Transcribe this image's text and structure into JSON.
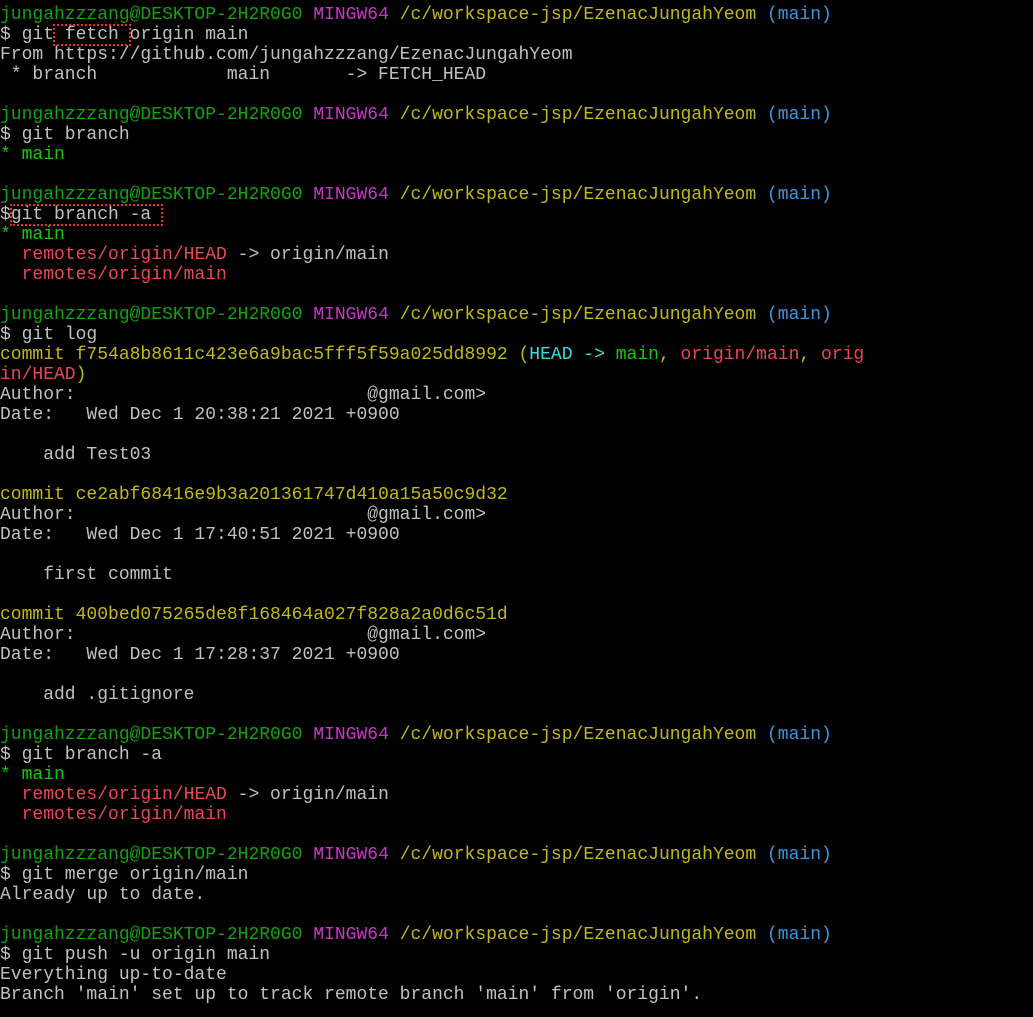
{
  "window": {
    "kind": "git-bash-terminal"
  },
  "colors": {
    "default": "#c0c0c0",
    "user_host": "#13a10e",
    "mingw": "#c836c8",
    "path": "#c1b81a",
    "branch_paren": "#3a96dd",
    "green": "#16c60c",
    "red": "#e74856",
    "yellow_hash": "#c1b81a",
    "head_cyan": "#3adbdb",
    "highlight_box": "#e03030"
  },
  "lines": [
    {
      "segs": [
        {
          "t": "jungahzzzang@DESKTOP-2H2R0G0",
          "c": "user_host"
        },
        {
          "t": " ",
          "c": "default"
        },
        {
          "t": "MINGW64",
          "c": "mingw"
        },
        {
          "t": " ",
          "c": "default"
        },
        {
          "t": "/c/workspace-jsp/EzenacJungahYeom",
          "c": "path"
        },
        {
          "t": " ",
          "c": "default"
        },
        {
          "t": "(main)",
          "c": "branch_paren"
        }
      ]
    },
    {
      "segs": [
        {
          "t": "$ git",
          "c": "default"
        },
        {
          "t": " fetch ",
          "c": "default",
          "hl": true
        },
        {
          "t": "origin main",
          "c": "default"
        }
      ]
    },
    {
      "segs": [
        {
          "t": "From https://github.com/jungahzzzang/EzenacJungahYeom",
          "c": "default"
        }
      ]
    },
    {
      "segs": [
        {
          "t": " * branch            main       -> FETCH_HEAD",
          "c": "default"
        }
      ]
    },
    {
      "segs": [
        {
          "t": "",
          "c": "default"
        }
      ]
    },
    {
      "segs": [
        {
          "t": "jungahzzzang@DESKTOP-2H2R0G0",
          "c": "user_host"
        },
        {
          "t": " ",
          "c": "default"
        },
        {
          "t": "MINGW64",
          "c": "mingw"
        },
        {
          "t": " ",
          "c": "default"
        },
        {
          "t": "/c/workspace-jsp/EzenacJungahYeom",
          "c": "path"
        },
        {
          "t": " ",
          "c": "default"
        },
        {
          "t": "(main)",
          "c": "branch_paren"
        }
      ]
    },
    {
      "segs": [
        {
          "t": "$ git branch",
          "c": "default"
        }
      ]
    },
    {
      "segs": [
        {
          "t": "* main",
          "c": "green"
        }
      ]
    },
    {
      "segs": [
        {
          "t": "",
          "c": "default"
        }
      ]
    },
    {
      "segs": [
        {
          "t": "jungahzzzang@DESKTOP-2H2R0G0",
          "c": "user_host"
        },
        {
          "t": " ",
          "c": "default"
        },
        {
          "t": "MINGW64",
          "c": "mingw"
        },
        {
          "t": " ",
          "c": "default"
        },
        {
          "t": "/c/workspace-jsp/EzenacJungahYeom",
          "c": "path"
        },
        {
          "t": " ",
          "c": "default"
        },
        {
          "t": "(main)",
          "c": "branch_paren"
        }
      ]
    },
    {
      "segs": [
        {
          "t": "$",
          "c": "default"
        },
        {
          "t": "git branch -a ",
          "c": "default",
          "hl": true
        }
      ]
    },
    {
      "segs": [
        {
          "t": "* main",
          "c": "green"
        }
      ]
    },
    {
      "segs": [
        {
          "t": "  ",
          "c": "default"
        },
        {
          "t": "remotes/origin/HEAD",
          "c": "red"
        },
        {
          "t": " -> origin/main",
          "c": "default"
        }
      ]
    },
    {
      "segs": [
        {
          "t": "  ",
          "c": "default"
        },
        {
          "t": "remotes/origin/main",
          "c": "red"
        }
      ]
    },
    {
      "segs": [
        {
          "t": "",
          "c": "default"
        }
      ]
    },
    {
      "segs": [
        {
          "t": "jungahzzzang@DESKTOP-2H2R0G0",
          "c": "user_host"
        },
        {
          "t": " ",
          "c": "default"
        },
        {
          "t": "MINGW64",
          "c": "mingw"
        },
        {
          "t": " ",
          "c": "default"
        },
        {
          "t": "/c/workspace-jsp/EzenacJungahYeom",
          "c": "path"
        },
        {
          "t": " ",
          "c": "default"
        },
        {
          "t": "(main)",
          "c": "branch_paren"
        }
      ]
    },
    {
      "segs": [
        {
          "t": "$ git log",
          "c": "default"
        }
      ]
    },
    {
      "segs": [
        {
          "t": "commit f754a8b8611c423e6a9bac5fff5f59a025dd8992 ",
          "c": "yellow_hash"
        },
        {
          "t": "(",
          "c": "yellow_hash"
        },
        {
          "t": "HEAD -> ",
          "c": "head_cyan"
        },
        {
          "t": "main",
          "c": "green"
        },
        {
          "t": ", ",
          "c": "yellow_hash"
        },
        {
          "t": "origin/main",
          "c": "red"
        },
        {
          "t": ", ",
          "c": "yellow_hash"
        },
        {
          "t": "orig",
          "c": "red"
        }
      ]
    },
    {
      "segs": [
        {
          "t": "in/HEAD",
          "c": "red"
        },
        {
          "t": ")",
          "c": "yellow_hash"
        }
      ]
    },
    {
      "segs": [
        {
          "t": "Author:                           @gmail.com>",
          "c": "default"
        }
      ]
    },
    {
      "segs": [
        {
          "t": "Date:   Wed Dec 1 20:38:21 2021 +0900",
          "c": "default"
        }
      ]
    },
    {
      "segs": [
        {
          "t": "",
          "c": "default"
        }
      ]
    },
    {
      "segs": [
        {
          "t": "    add Test03",
          "c": "default"
        }
      ]
    },
    {
      "segs": [
        {
          "t": "",
          "c": "default"
        }
      ]
    },
    {
      "segs": [
        {
          "t": "commit ce2abf68416e9b3a201361747d410a15a50c9d32",
          "c": "yellow_hash"
        }
      ]
    },
    {
      "segs": [
        {
          "t": "Author:                           @gmail.com>",
          "c": "default"
        }
      ]
    },
    {
      "segs": [
        {
          "t": "Date:   Wed Dec 1 17:40:51 2021 +0900",
          "c": "default"
        }
      ]
    },
    {
      "segs": [
        {
          "t": "",
          "c": "default"
        }
      ]
    },
    {
      "segs": [
        {
          "t": "    first commit",
          "c": "default"
        }
      ]
    },
    {
      "segs": [
        {
          "t": "",
          "c": "default"
        }
      ]
    },
    {
      "segs": [
        {
          "t": "commit 400bed075265de8f168464a027f828a2a0d6c51d",
          "c": "yellow_hash"
        }
      ]
    },
    {
      "segs": [
        {
          "t": "Author:                           @gmail.com>",
          "c": "default"
        }
      ]
    },
    {
      "segs": [
        {
          "t": "Date:   Wed Dec 1 17:28:37 2021 +0900",
          "c": "default"
        }
      ]
    },
    {
      "segs": [
        {
          "t": "",
          "c": "default"
        }
      ]
    },
    {
      "segs": [
        {
          "t": "    add .gitignore",
          "c": "default"
        }
      ]
    },
    {
      "segs": [
        {
          "t": "",
          "c": "default"
        }
      ]
    },
    {
      "segs": [
        {
          "t": "jungahzzzang@DESKTOP-2H2R0G0",
          "c": "user_host"
        },
        {
          "t": " ",
          "c": "default"
        },
        {
          "t": "MINGW64",
          "c": "mingw"
        },
        {
          "t": " ",
          "c": "default"
        },
        {
          "t": "/c/workspace-jsp/EzenacJungahYeom",
          "c": "path"
        },
        {
          "t": " ",
          "c": "default"
        },
        {
          "t": "(main)",
          "c": "branch_paren"
        }
      ]
    },
    {
      "segs": [
        {
          "t": "$ git branch -a",
          "c": "default"
        }
      ]
    },
    {
      "segs": [
        {
          "t": "* main",
          "c": "green"
        }
      ]
    },
    {
      "segs": [
        {
          "t": "  ",
          "c": "default"
        },
        {
          "t": "remotes/origin/HEAD",
          "c": "red"
        },
        {
          "t": " -> origin/main",
          "c": "default"
        }
      ]
    },
    {
      "segs": [
        {
          "t": "  ",
          "c": "default"
        },
        {
          "t": "remotes/origin/main",
          "c": "red"
        }
      ]
    },
    {
      "segs": [
        {
          "t": "",
          "c": "default"
        }
      ]
    },
    {
      "segs": [
        {
          "t": "jungahzzzang@DESKTOP-2H2R0G0",
          "c": "user_host"
        },
        {
          "t": " ",
          "c": "default"
        },
        {
          "t": "MINGW64",
          "c": "mingw"
        },
        {
          "t": " ",
          "c": "default"
        },
        {
          "t": "/c/workspace-jsp/EzenacJungahYeom",
          "c": "path"
        },
        {
          "t": " ",
          "c": "default"
        },
        {
          "t": "(main)",
          "c": "branch_paren"
        }
      ]
    },
    {
      "segs": [
        {
          "t": "$ git merge origin/main",
          "c": "default"
        }
      ]
    },
    {
      "segs": [
        {
          "t": "Already up to date.",
          "c": "default"
        }
      ]
    },
    {
      "segs": [
        {
          "t": "",
          "c": "default"
        }
      ]
    },
    {
      "segs": [
        {
          "t": "jungahzzzang@DESKTOP-2H2R0G0",
          "c": "user_host"
        },
        {
          "t": " ",
          "c": "default"
        },
        {
          "t": "MINGW64",
          "c": "mingw"
        },
        {
          "t": " ",
          "c": "default"
        },
        {
          "t": "/c/workspace-jsp/EzenacJungahYeom",
          "c": "path"
        },
        {
          "t": " ",
          "c": "default"
        },
        {
          "t": "(main)",
          "c": "branch_paren"
        }
      ]
    },
    {
      "segs": [
        {
          "t": "$ git push -u origin main",
          "c": "default"
        }
      ]
    },
    {
      "segs": [
        {
          "t": "Everything up-to-date",
          "c": "default"
        }
      ]
    },
    {
      "segs": [
        {
          "t": "Branch 'main' set up to track remote branch 'main' from 'origin'.",
          "c": "default"
        }
      ]
    }
  ]
}
